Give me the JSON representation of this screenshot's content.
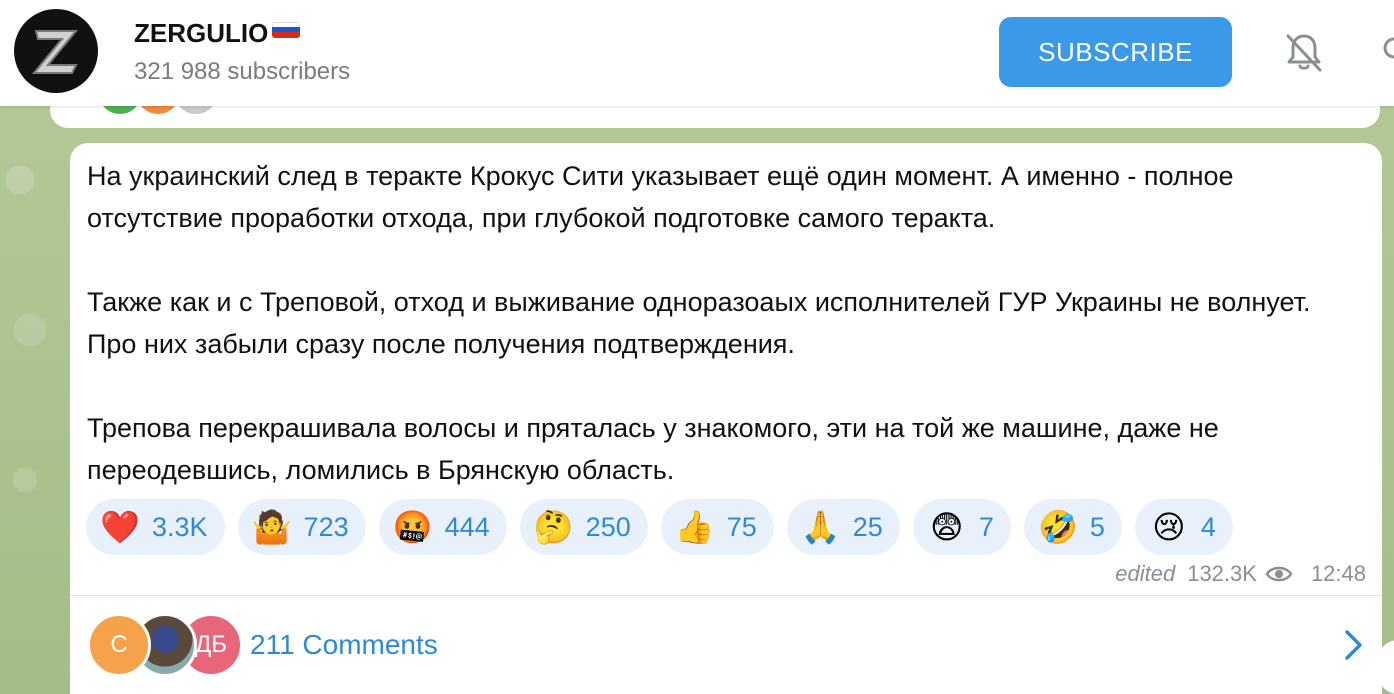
{
  "header": {
    "channel_name": "ZERGULIO",
    "subscribers": "321 988 subscribers",
    "subscribe_label": "SUBSCRIBE",
    "avatar_letter": "Z"
  },
  "message": {
    "paragraphs": [
      "На украинский след в теракте Крокус Сити указывает ещё один момент. А именно - полное отсутствие проработки отхода, при глубокой подготовке самого теракта.",
      "Также как и с Треповой, отход и выживание одноразоаых исполнителей ГУР Украины не волнует. Про них забыли сразу после получения подтверждения.",
      "Трепова перекрашивала волосы и пряталась у знакомого, эти на той же машине, даже не переодевшись, ломились в Брянскую область."
    ],
    "reactions": [
      {
        "icon": "heart-icon",
        "glyph": "❤️",
        "count": "3.3K"
      },
      {
        "icon": "shrug-icon",
        "glyph": "🤷",
        "count": "723"
      },
      {
        "icon": "cursing-face-icon",
        "glyph": "🤬",
        "count": "444"
      },
      {
        "icon": "thinking-face-icon",
        "glyph": "🤔",
        "count": "250"
      },
      {
        "icon": "thumbs-up-icon",
        "glyph": "👍",
        "count": "75"
      },
      {
        "icon": "folded-hands-icon",
        "glyph": "🙏",
        "count": "25"
      },
      {
        "icon": "fearful-face-icon",
        "glyph": "😨",
        "count": "7"
      },
      {
        "icon": "rofl-icon",
        "glyph": "🤣",
        "count": "5"
      },
      {
        "icon": "crying-face-icon",
        "glyph": "😢",
        "count": "4"
      }
    ],
    "edited_label": "edited",
    "views": "132.3K",
    "time": "12:48"
  },
  "comments": {
    "label": "211 Comments",
    "avatars": [
      {
        "initials": "С",
        "color": "#f5a24a"
      },
      {
        "initials": "",
        "color": "#5a6a7a"
      },
      {
        "initials": "ДБ",
        "color": "#e8657a"
      }
    ]
  },
  "colors": {
    "accent": "#3a9ae9",
    "reaction_bg": "#e8f1fb",
    "reaction_text": "#2f8ad6"
  }
}
